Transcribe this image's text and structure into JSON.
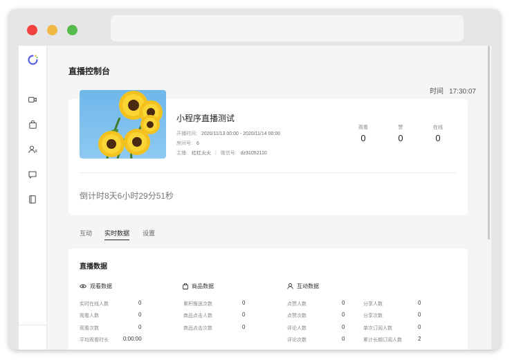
{
  "page_title": "直播控制台",
  "time": {
    "label": "时间",
    "value": "17:30:07"
  },
  "live": {
    "title": "小程序直播测试",
    "schedule_label": "开播时间:",
    "schedule_value": "2020/11/13 00:00 - 2020/11/14 00:00",
    "room_label": "房间号:",
    "room_value": "6",
    "host_label": "主播:",
    "host_value": "红红火火",
    "wechat_label": "微信号:",
    "wechat_value": "dz31052110",
    "cover_icon": "sunflower-image"
  },
  "stats": [
    {
      "label": "观看",
      "value": "0"
    },
    {
      "label": "赞",
      "value": "0"
    },
    {
      "label": "在线",
      "value": "0"
    }
  ],
  "countdown": "倒计时8天6小时29分51秒",
  "tabs": [
    "互动",
    "实时数据",
    "设置"
  ],
  "active_tab": "实时数据",
  "data_title": "直播数据",
  "sections": {
    "viewing": {
      "title": "观看数据",
      "icon": "eye-icon",
      "rows": [
        {
          "label": "实时在线人数",
          "value": "0"
        },
        {
          "label": "观看人数",
          "value": "0"
        },
        {
          "label": "观看次数",
          "value": "0"
        },
        {
          "label": "平均观看时长",
          "value": "0:00:00"
        }
      ]
    },
    "goods": {
      "title": "商品数据",
      "icon": "bag-icon",
      "rows": [
        {
          "label": "累积推送次数",
          "value": "0"
        },
        {
          "label": "商品点击人数",
          "value": "0"
        },
        {
          "label": "商品点击次数",
          "value": "0"
        }
      ]
    },
    "interaction": {
      "title": "互动数据",
      "icon": "user-icon",
      "rows_left": [
        {
          "label": "点赞人数",
          "value": "0"
        },
        {
          "label": "点赞次数",
          "value": "0"
        },
        {
          "label": "评论人数",
          "value": "0"
        },
        {
          "label": "评论次数",
          "value": "0"
        }
      ],
      "rows_right": [
        {
          "label": "分享人数",
          "value": "0"
        },
        {
          "label": "分享次数",
          "value": "0"
        },
        {
          "label": "单次订阅人数",
          "value": "0"
        },
        {
          "label": "累计长期订阅人数",
          "value": "2"
        }
      ]
    }
  },
  "sidebar_icons": [
    "logo-icon",
    "video-icon",
    "bag-icon",
    "users-icon",
    "chat-icon",
    "book-icon"
  ],
  "colors": {
    "accent": "#5b5fe8",
    "close": "#f0413f",
    "minimize": "#f2b844",
    "maximize": "#56bb4c"
  }
}
